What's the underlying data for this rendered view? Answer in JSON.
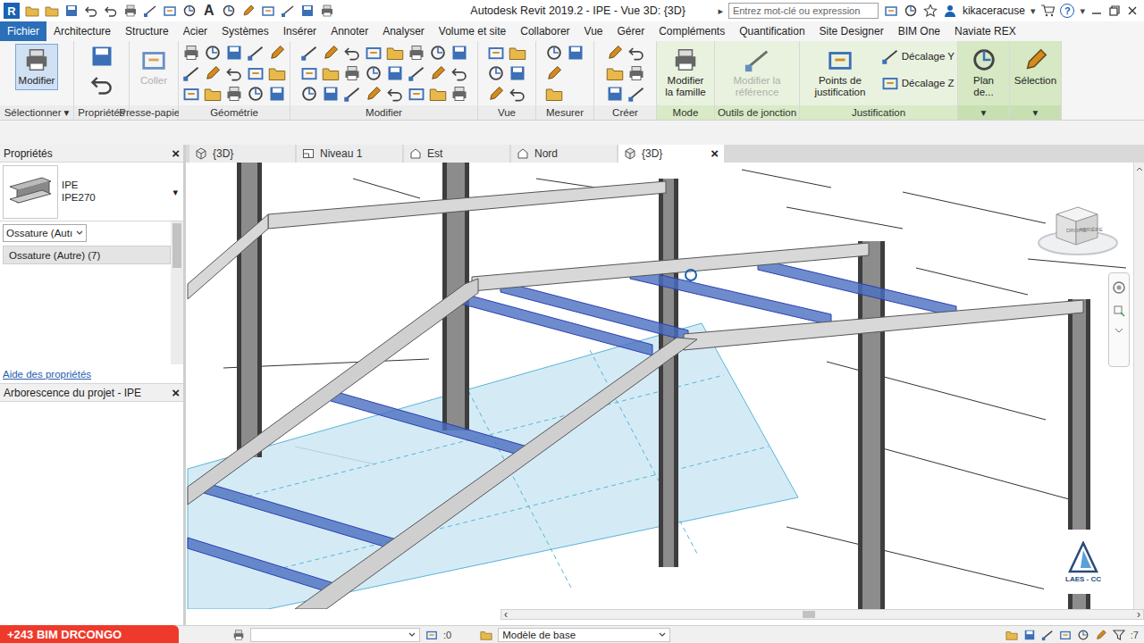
{
  "window": {
    "app_letter": "R",
    "text_tool": "A",
    "title": "Autodesk Revit 2019.2 - IPE - Vue 3D: {3D}",
    "title_arrow": "▸",
    "search_placeholder": "Entrez mot-clé ou expression",
    "user": "kikaceracuse",
    "caret": "▾",
    "help": "?"
  },
  "menu_tabs": [
    {
      "label": "Fichier",
      "selected": true
    },
    {
      "label": "Architecture",
      "selected": false
    },
    {
      "label": "Structure",
      "selected": false
    },
    {
      "label": "Acier",
      "selected": false
    },
    {
      "label": "Systèmes",
      "selected": false
    },
    {
      "label": "Insérer",
      "selected": false
    },
    {
      "label": "Annoter",
      "selected": false
    },
    {
      "label": "Analyser",
      "selected": false
    },
    {
      "label": "Volume et site",
      "selected": false
    },
    {
      "label": "Collaborer",
      "selected": false
    },
    {
      "label": "Vue",
      "selected": false
    },
    {
      "label": "Gérer",
      "selected": false
    },
    {
      "label": "Compléments",
      "selected": false
    },
    {
      "label": "Quantification",
      "selected": false
    },
    {
      "label": "Site Designer",
      "selected": false
    },
    {
      "label": "BIM One",
      "selected": false
    },
    {
      "label": "Naviate REX",
      "selected": false
    }
  ],
  "ribbon": {
    "caret": "▾",
    "panels": [
      {
        "label": "Sélectionner",
        "dropdown": true,
        "kind": "standard",
        "buttons": [
          {
            "label": "Modifier",
            "kind": "large",
            "selected": true,
            "disabled": false
          }
        ]
      },
      {
        "label": "Propriétés",
        "dropdown": false,
        "kind": "standard",
        "buttons": []
      },
      {
        "label": "Presse-papiers",
        "dropdown": false,
        "kind": "standard",
        "buttons": [
          {
            "label": "Coller",
            "kind": "large",
            "selected": false,
            "disabled": true
          }
        ]
      },
      {
        "label": "Géométrie",
        "dropdown": false,
        "kind": "standard",
        "buttons": []
      },
      {
        "label": "Modifier",
        "dropdown": false,
        "kind": "standard",
        "buttons": []
      },
      {
        "label": "Vue",
        "dropdown": false,
        "kind": "standard",
        "buttons": []
      },
      {
        "label": "Mesurer",
        "dropdown": false,
        "kind": "standard",
        "buttons": []
      },
      {
        "label": "Créer",
        "dropdown": false,
        "kind": "standard",
        "buttons": []
      },
      {
        "label": "Mode",
        "dropdown": false,
        "kind": "context",
        "buttons": [
          {
            "label": "Modifier la famille",
            "kind": "large",
            "selected": false,
            "disabled": false
          }
        ]
      },
      {
        "label": "Outils de jonction",
        "dropdown": false,
        "kind": "context",
        "buttons": [
          {
            "label": "Modifier la référence",
            "kind": "large",
            "selected": false,
            "disabled": true
          }
        ]
      },
      {
        "label": "Justification",
        "dropdown": false,
        "kind": "context",
        "buttons": [
          {
            "label": "Points de justification",
            "kind": "large",
            "selected": false,
            "disabled": false
          },
          {
            "label": "Décalage Y",
            "kind": "small",
            "selected": false,
            "disabled": false
          },
          {
            "label": "Décalage Z",
            "kind": "small",
            "selected": false,
            "disabled": false
          }
        ]
      },
      {
        "label": "",
        "dropdown": true,
        "kind": "context-tool",
        "buttons": [
          {
            "label": "Plan de...",
            "kind": "large",
            "selected": false,
            "disabled": false
          }
        ]
      },
      {
        "label": "",
        "dropdown": true,
        "kind": "context-tool",
        "buttons": [
          {
            "label": "Sélection",
            "kind": "large",
            "selected": false,
            "disabled": false
          }
        ]
      }
    ]
  },
  "properties": {
    "title": "Propriétés",
    "close": "×",
    "family": "IPE",
    "type": "IPE270",
    "type_caret": "▾",
    "filter": "Ossature (Autı",
    "instances": "Ossature (Autre) (7)",
    "help_link": "Aide des propriétés"
  },
  "project_browser": {
    "title": "Arborescence du projet - IPE",
    "close": "×"
  },
  "views": {
    "close": "×",
    "tabs": [
      {
        "label": "{3D}",
        "kind": "3d",
        "selected": false
      },
      {
        "label": "Niveau 1",
        "kind": "plan",
        "selected": false
      },
      {
        "label": "Est",
        "kind": "elevation",
        "selected": false
      },
      {
        "label": "Nord",
        "kind": "elevation",
        "selected": false
      },
      {
        "label": "{3D}",
        "kind": "3d",
        "selected": true
      }
    ]
  },
  "viewcube": {
    "faces": [
      "DROITE",
      "ARRIÈRE"
    ]
  },
  "watermark_logo": "LAES - CC",
  "scrollbar": {
    "left": "‹",
    "right": "›"
  },
  "status_bar": {
    "selection_count": ":0",
    "model": "Modèle de base",
    "filter_count": ":7"
  },
  "badge": "+243 BIM DRCONGO"
}
